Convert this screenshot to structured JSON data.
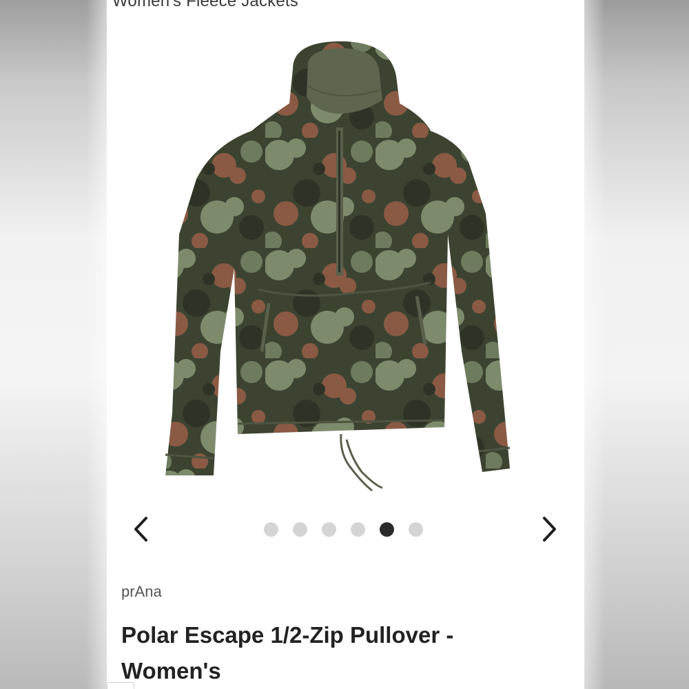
{
  "page": {
    "category": "Women's Fleece Jackets",
    "brand": "prAna",
    "product_title": "Polar Escape 1/2-Zip Pullover - Women's"
  },
  "carousel": {
    "prev_icon": "chevron-left-icon",
    "next_icon": "chevron-right-icon",
    "total_slides": 6,
    "active_index": 4
  },
  "image": {
    "subject": "camouflage sherpa fleece hooded half-zip pullover",
    "colors": {
      "base": "#3c4431",
      "sage": "#7d8a6c",
      "rust": "#8a5a45",
      "dark": "#2e3326",
      "trim": "#5a604b"
    }
  },
  "colors": {
    "dot_inactive": "#d4d4d4",
    "dot_active": "#2b2b2b",
    "text": "#222222"
  }
}
